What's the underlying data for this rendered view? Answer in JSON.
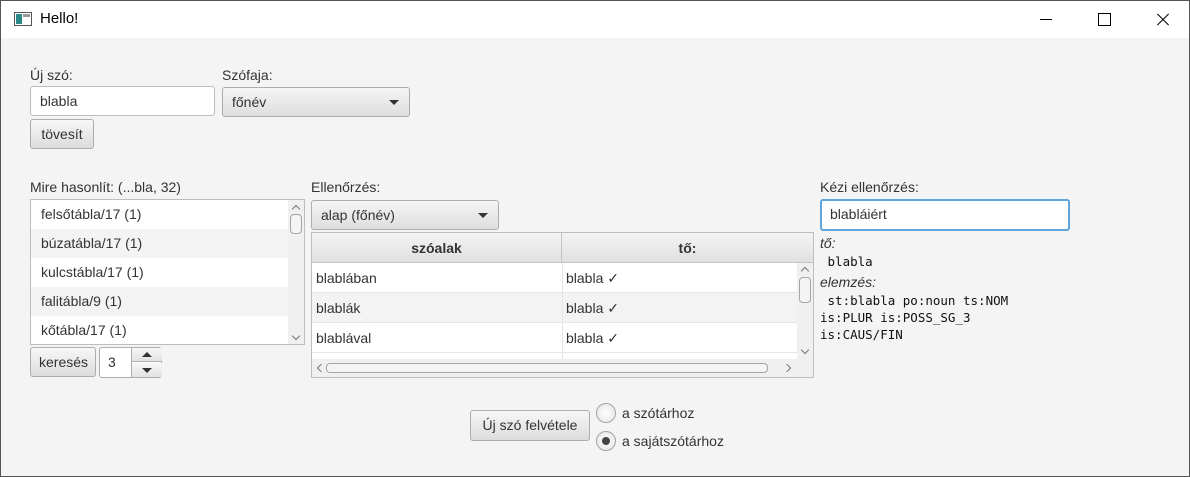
{
  "window": {
    "title": "Hello!"
  },
  "new_word": {
    "label": "Új szó:",
    "value": "blabla",
    "stem_button": "tövesít"
  },
  "word_class": {
    "label": "Szófaja:",
    "selected": "főnév"
  },
  "similar": {
    "label": "Mire hasonlít:  (...bla, 32)",
    "items": [
      "felsőtábla/17 (1)",
      "búzatábla/17 (1)",
      "kulcstábla/17 (1)",
      "falitábla/9 (1)",
      "kőtábla/17 (1)"
    ],
    "search_button": "keresés",
    "count": "3"
  },
  "check": {
    "label": "Ellenőrzés:",
    "selected": "alap (főnév)",
    "columns": [
      "szóalak",
      "tő:"
    ],
    "rows": [
      {
        "form": "blablában",
        "stem": "blabla ✓"
      },
      {
        "form": "blablák",
        "stem": "blabla ✓"
      },
      {
        "form": "blablával",
        "stem": "blabla ✓"
      }
    ]
  },
  "manual": {
    "label": "Kézi ellenőrzés:",
    "value": "blabláiért",
    "stem_label": "tő:",
    "stem_value": " blabla",
    "analysis_label": "elemzés:",
    "analysis_lines": [
      " st:blabla po:noun ts:NOM",
      "is:PLUR is:POSS_SG_3",
      "is:CAUS/FIN"
    ]
  },
  "add": {
    "button": "Új szó felvétele",
    "options": [
      {
        "label": "a szótárhoz",
        "checked": false
      },
      {
        "label": "a sajátszótárhoz",
        "checked": true
      }
    ]
  }
}
